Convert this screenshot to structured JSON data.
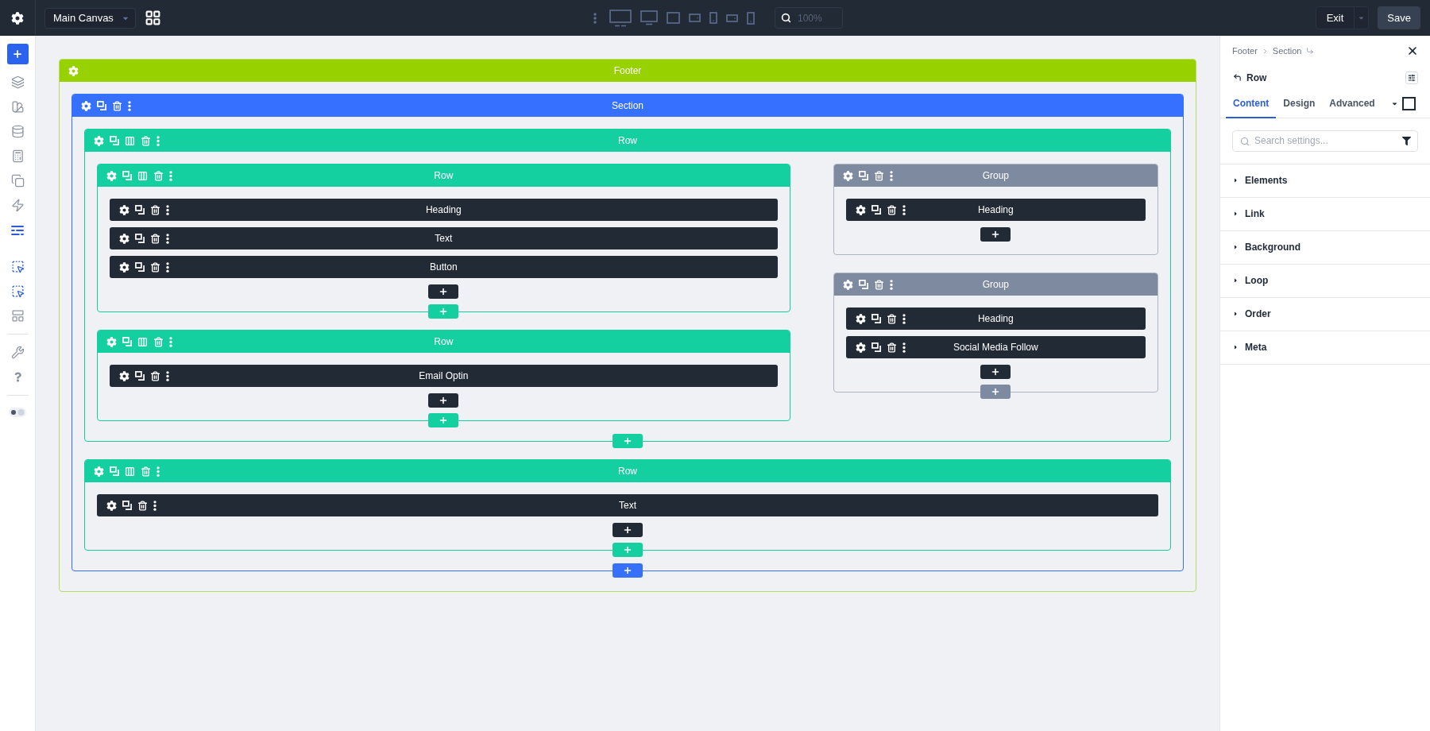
{
  "topbar": {
    "canvas_select": {
      "value": "Main Canvas"
    },
    "zoom_field": {
      "value": "100%"
    },
    "exit_button": "Exit",
    "save_button": "Save"
  },
  "sidebar": {
    "main_items": [
      {
        "active": false
      },
      {
        "active": false
      },
      {
        "active": false
      },
      {
        "active": false
      },
      {
        "active": false
      },
      {
        "active": false
      },
      {
        "active": true
      }
    ],
    "selection_items": [
      {
        "active": true
      },
      {
        "active": true
      },
      {
        "active": false
      }
    ],
    "utility_items": [
      {
        "active": false
      },
      {
        "active": false
      }
    ]
  },
  "canvas": {
    "kind": "footer",
    "label": "Footer",
    "children": [
      {
        "kind": "section",
        "label": "Section",
        "add_below": true,
        "children": [
          {
            "kind": "row",
            "label": "Row",
            "add_inside": false,
            "add_below": true,
            "columns": [
              [
                {
                  "kind": "row",
                  "label": "Row",
                  "add_inside": true,
                  "add_below": true,
                  "columns": [
                    [
                      {
                        "kind": "module",
                        "label": "Heading"
                      },
                      {
                        "kind": "module",
                        "label": "Text"
                      },
                      {
                        "kind": "module",
                        "label": "Button"
                      }
                    ]
                  ]
                },
                {
                  "kind": "row",
                  "label": "Row",
                  "add_inside": true,
                  "add_below": true,
                  "columns": [
                    [
                      {
                        "kind": "module",
                        "label": "Email Optin"
                      }
                    ]
                  ]
                }
              ],
              [
                {
                  "kind": "group",
                  "label": "Group",
                  "add_inside": true,
                  "add_below": false,
                  "children": [
                    {
                      "kind": "module",
                      "label": "Heading"
                    }
                  ]
                },
                {
                  "kind": "group",
                  "label": "Group",
                  "add_inside": true,
                  "add_below": true,
                  "children": [
                    {
                      "kind": "module",
                      "label": "Heading"
                    },
                    {
                      "kind": "module",
                      "label": "Social Media Follow"
                    }
                  ]
                }
              ]
            ]
          },
          {
            "kind": "row",
            "label": "Row",
            "add_inside": true,
            "add_below": true,
            "columns": [
              [
                {
                  "kind": "module",
                  "label": "Text"
                }
              ]
            ]
          }
        ]
      }
    ]
  },
  "panel": {
    "breadcrumb": [
      "Footer",
      "Section"
    ],
    "title": "Row",
    "tabs": [
      {
        "label": "Content",
        "selected": true
      },
      {
        "label": "Design",
        "selected": false
      },
      {
        "label": "Advanced",
        "selected": false
      }
    ],
    "search": {
      "placeholder": "Search settings..."
    },
    "sections": [
      {
        "label": "Elements",
        "expanded": false
      },
      {
        "label": "Link",
        "expanded": false
      },
      {
        "label": "Background",
        "expanded": false
      },
      {
        "label": "Loop",
        "expanded": false
      },
      {
        "label": "Order",
        "expanded": false
      },
      {
        "label": "Meta",
        "expanded": false
      }
    ]
  }
}
